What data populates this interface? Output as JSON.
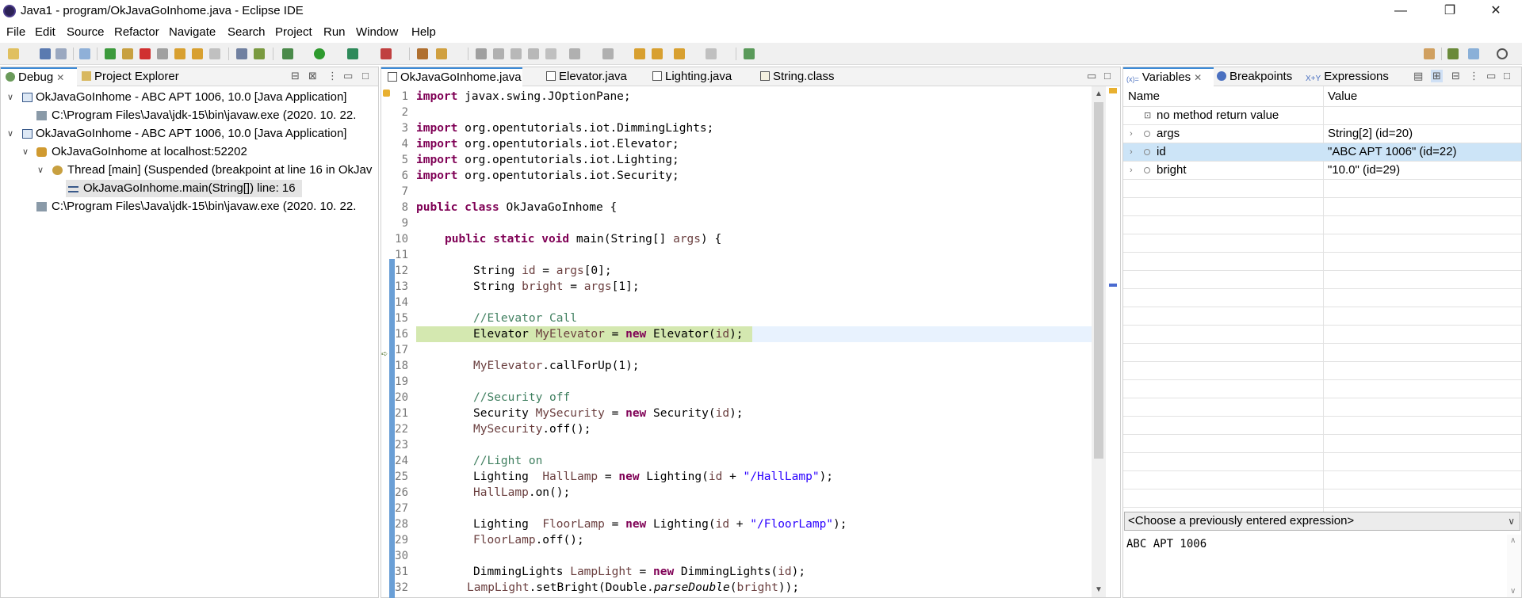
{
  "window": {
    "title": "Java1 - program/OkJavaGoInhome.java - Eclipse IDE",
    "minimize": "—",
    "restore": "❐",
    "close": "✕"
  },
  "menu": [
    "File",
    "Edit",
    "Source",
    "Refactor",
    "Navigate",
    "Search",
    "Project",
    "Run",
    "Window",
    "Help"
  ],
  "debug_view": {
    "tabs": [
      {
        "label": "Debug",
        "icon": "debug-icon",
        "active": true
      },
      {
        "label": "Project Explorer",
        "icon": "project-explorer-icon",
        "active": false
      }
    ],
    "tree": [
      {
        "label": "OkJavaGoInhome - ABC APT 1006, 10.0 [Java Application]",
        "icon": "java-application-icon"
      },
      {
        "label": "C:\\Program Files\\Java\\jdk-15\\bin\\javaw.exe (2020. 10. 22.",
        "icon": "process-icon"
      },
      {
        "label": "OkJavaGoInhome - ABC APT 1006, 10.0 [Java Application]",
        "icon": "java-application-icon"
      },
      {
        "label": "OkJavaGoInhome at localhost:52202",
        "icon": "debug-target-icon"
      },
      {
        "label": "Thread [main] (Suspended (breakpoint at line 16 in OkJav",
        "icon": "thread-icon"
      },
      {
        "label": "OkJavaGoInhome.main(String[]) line: 16",
        "icon": "stack-frame-icon"
      },
      {
        "label": "C:\\Program Files\\Java\\jdk-15\\bin\\javaw.exe (2020. 10. 22.",
        "icon": "process-icon"
      }
    ]
  },
  "editor": {
    "tabs": [
      {
        "label": "OkJavaGoInhome.java",
        "active": true
      },
      {
        "label": "Elevator.java",
        "active": false
      },
      {
        "label": "Lighting.java",
        "active": false
      },
      {
        "label": "String.class",
        "active": false
      }
    ],
    "line_numbers": [
      "1",
      "2",
      "3",
      "4",
      "5",
      "6",
      "7",
      "8",
      "9",
      "10",
      "11",
      "12",
      "13",
      "14",
      "15",
      "16",
      "17",
      "18",
      "19",
      "20",
      "21",
      "22",
      "23",
      "24",
      "25",
      "26",
      "27",
      "28",
      "29",
      "30",
      "31",
      "32"
    ],
    "code": {
      "l1_kw": "import",
      "l1_rest": " javax.swing.JOptionPane;",
      "l3_kw": "import",
      "l3_rest": " org.opentutorials.iot.DimmingLights;",
      "l4_kw": "import",
      "l4_rest": " org.opentutorials.iot.Elevator;",
      "l5_kw": "import",
      "l5_rest": " org.opentutorials.iot.Lighting;",
      "l6_kw": "import",
      "l6_rest": " org.opentutorials.iot.Security;",
      "l8_kw": "public class",
      "l8_rest": " OkJavaGoInhome {",
      "l10_kw": "public static void",
      "l10_a": " main(String[] ",
      "l10_var": "args",
      "l10_b": ") {",
      "l12_a": "String ",
      "l12_v1": "id",
      "l12_b": " = ",
      "l12_v2": "args",
      "l12_c": "[0];",
      "l13_a": "String ",
      "l13_v1": "bright",
      "l13_b": " = ",
      "l13_v2": "args",
      "l13_c": "[1];",
      "l15_cm": "//Elevator Call",
      "l16_a": "Elevator ",
      "l16_v1": "MyElevator",
      "l16_b": " = ",
      "l16_kw": "new",
      "l16_c": " Elevator(",
      "l16_v2": "id",
      "l16_d": ");",
      "l18_v": "MyElevator",
      "l18_rest": ".callForUp(1);",
      "l20_cm": "//Security off",
      "l21_a": "Security ",
      "l21_v1": "MySecurity",
      "l21_b": " = ",
      "l21_kw": "new",
      "l21_c": " Security(",
      "l21_v2": "id",
      "l21_d": ");",
      "l22_v": "MySecurity",
      "l22_rest": ".off();",
      "l24_cm": "//Light on",
      "l25_a": "Lighting  ",
      "l25_v1": "HallLamp",
      "l25_b": " = ",
      "l25_kw": "new",
      "l25_c": " Lighting(",
      "l25_v2": "id",
      "l25_d": " + ",
      "l25_str": "\"/HallLamp\"",
      "l25_e": ");",
      "l26_v": "HallLamp",
      "l26_rest": ".on();",
      "l28_a": "Lighting  ",
      "l28_v1": "FloorLamp",
      "l28_b": " = ",
      "l28_kw": "new",
      "l28_c": " Lighting(",
      "l28_v2": "id",
      "l28_d": " + ",
      "l28_str": "\"/FloorLamp\"",
      "l28_e": ");",
      "l29_v": "FloorLamp",
      "l29_rest": ".off();",
      "l31_a": "DimmingLights ",
      "l31_v1": "LampLight",
      "l31_b": " = ",
      "l31_kw": "new",
      "l31_c": " DimmingLights(",
      "l31_v2": "id",
      "l31_d": ");",
      "l32_v": "LampLight",
      "l32_a": ".setBright(Double.",
      "l32_it": "parseDouble",
      "l32_b": "(",
      "l32_v2": "bright",
      "l32_c": "));"
    }
  },
  "variables_view": {
    "tabs": [
      {
        "label": "Variables",
        "icon": "variables-icon",
        "active": true
      },
      {
        "label": "Breakpoints",
        "icon": "breakpoints-icon",
        "active": false
      },
      {
        "label": "Expressions",
        "icon": "expressions-icon",
        "active": false
      }
    ],
    "columns": {
      "name": "Name",
      "value": "Value"
    },
    "rows": [
      {
        "name": "no method return value",
        "value": ""
      },
      {
        "name": "args",
        "value": "String[2]  (id=20)"
      },
      {
        "name": "id",
        "value": "\"ABC APT 1006\" (id=22)"
      },
      {
        "name": "bright",
        "value": "\"10.0\" (id=29)"
      }
    ],
    "expression_combo": "<Choose a previously entered expression>",
    "detail_text": "ABC APT 1006"
  },
  "colors": {
    "highlight_line": "#d4e8b0",
    "selected_row": "#cce4f7",
    "keyword": "#7f0055",
    "comment": "#3f7f5f",
    "string": "#2a00ff",
    "local_var": "#6a3e3e",
    "active_tab_border": "#3c8ad6"
  }
}
